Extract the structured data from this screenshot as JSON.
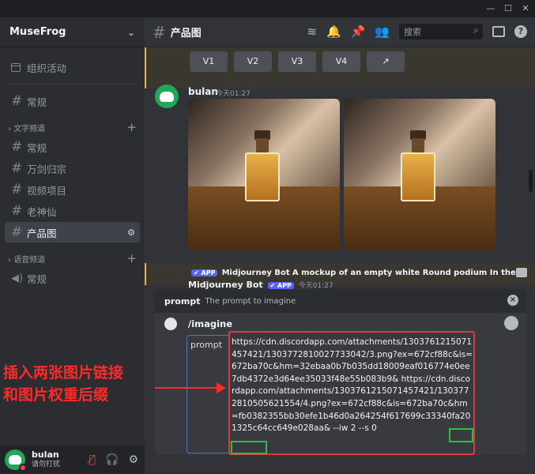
{
  "window": {
    "min": "—",
    "max": "☐",
    "close": "✕"
  },
  "server": {
    "name": "MuseFrog",
    "chevron": "⌄"
  },
  "sidebar": {
    "event_item": "组织活动",
    "top_channel": "常规",
    "text_category": "文字频道",
    "text_channels": [
      "常规",
      "万剑归宗",
      "视频项目",
      "老神仙",
      "产品图"
    ],
    "voice_category": "语音频道",
    "voice_channels": [
      "常规"
    ],
    "plus": "+"
  },
  "user": {
    "name": "bulan",
    "status": "请勿打扰"
  },
  "topbar": {
    "channel": "产品图",
    "search_placeholder": "搜索"
  },
  "variation_buttons": [
    "V1",
    "V2",
    "V3",
    "V4",
    "↗"
  ],
  "message": {
    "author": "bulan",
    "time": "今天01:27"
  },
  "mj_reply": {
    "app": "✔ APP",
    "bot": "Midjourney Bot",
    "text": "A mockup of an empty white Round podium In the ..."
  },
  "mj_author": {
    "name": "Midjourney Bot",
    "app": "✔ APP",
    "time": "今天01:27"
  },
  "command": {
    "name": "prompt",
    "desc": "The prompt to imagine",
    "slash": "/imagine",
    "param": "prompt"
  },
  "prompt_value": "https://cdn.discordapp.com/attachments/1303761215071457421/1303772810027733042/3.png?ex=672cf88c&is=672ba70c&hm=32ebaa0b7b035dd18009eaf016774e0ee7db4372e3d64ee35033f48e55b083b9& https://cdn.discordapp.com/attachments/1303761215071457421/1303772810505621554/4.png?ex=672cf88c&is=672ba70c&hm=fb0382355bb30efe1b46d0a264254f617699c33340fa201325c64cc649e028aa& --iw 2 --s 0",
  "annotation": {
    "line1": "插入两张图片链接",
    "line2": "和图片权重后缀"
  },
  "colors": {
    "accent": "#5865f2",
    "highlight": "#f0b232",
    "annotation": "#ff2a2a",
    "status_green": "#23a55a"
  }
}
